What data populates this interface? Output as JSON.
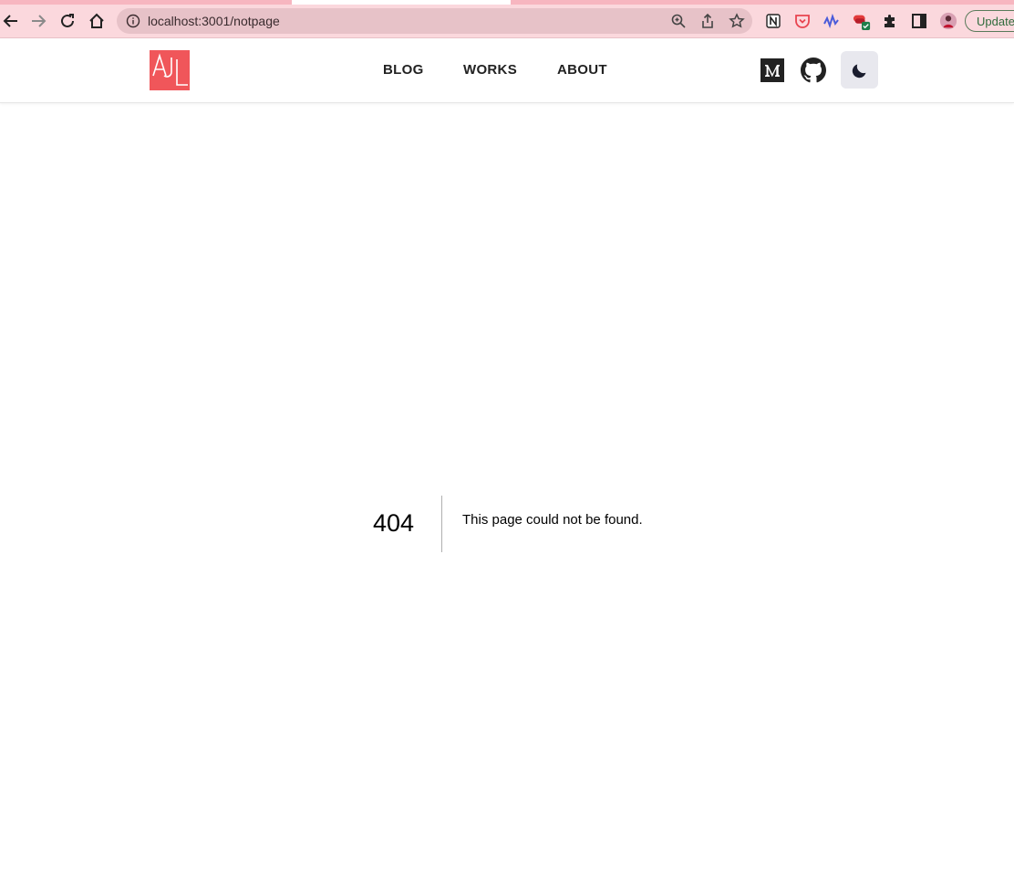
{
  "browser": {
    "url": "localhost:3001/notpage",
    "update_label": "Update"
  },
  "site": {
    "logo_text": "AJL",
    "nav": [
      {
        "label": "BLOG"
      },
      {
        "label": "WORKS"
      },
      {
        "label": "ABOUT"
      }
    ],
    "social": [
      "medium-icon",
      "github-icon"
    ],
    "theme_toggle_icon": "moon-icon"
  },
  "error": {
    "code": "404",
    "message": "This page could not be found."
  },
  "colors": {
    "toolbar": "#fbd8dd",
    "omnibox": "#e7c2c8",
    "logo": "#f0565a",
    "theme_button": "#e8e8ee"
  }
}
